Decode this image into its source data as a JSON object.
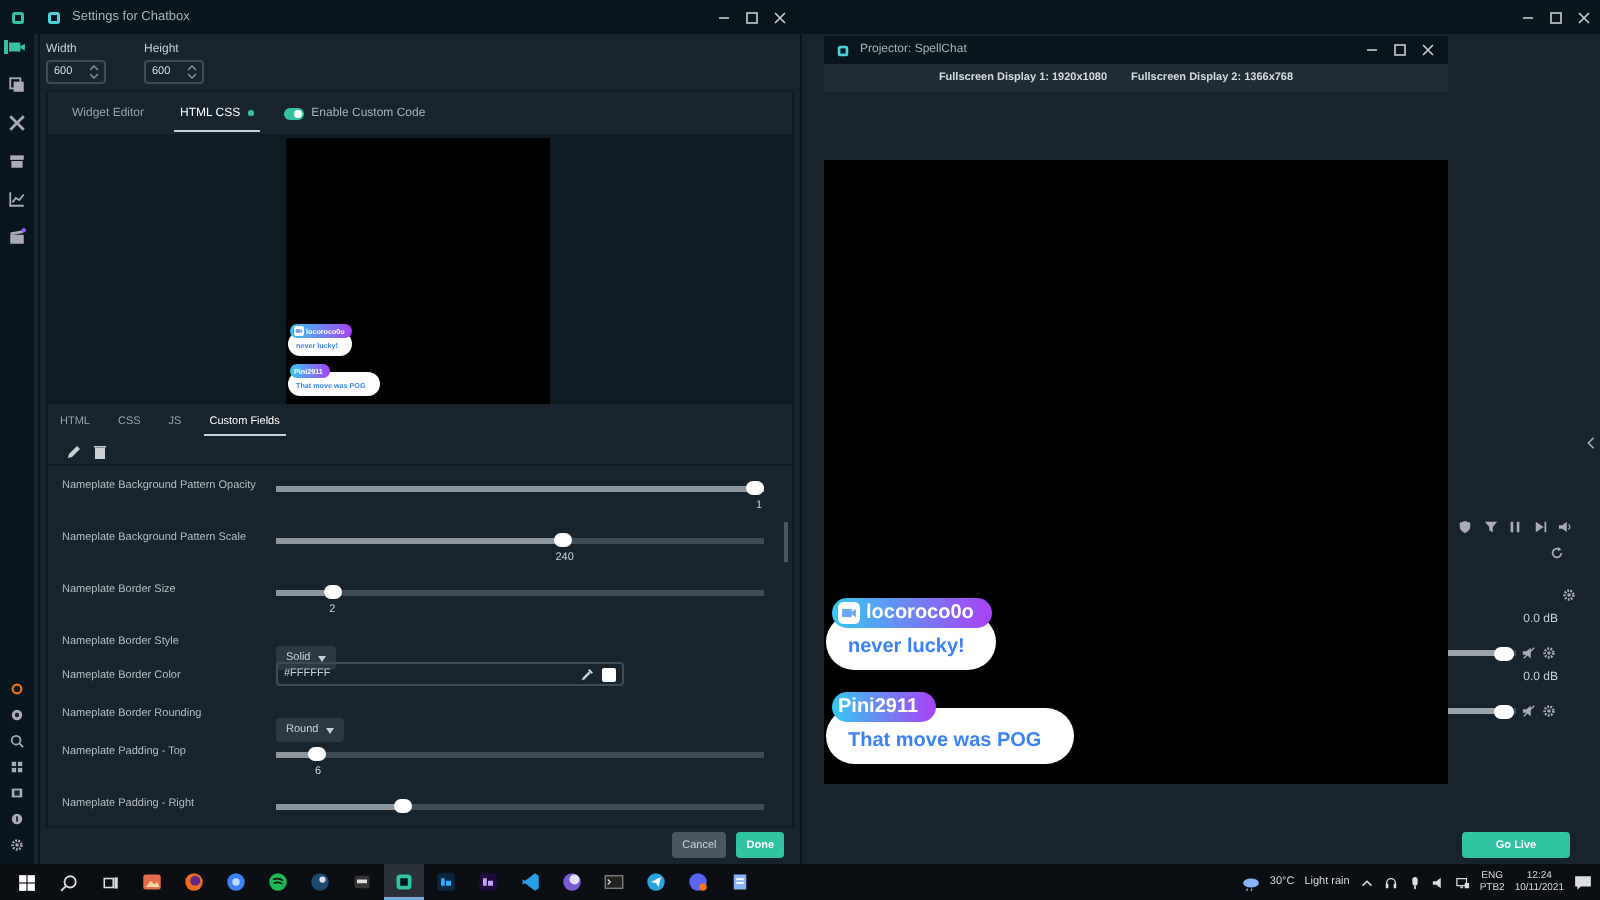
{
  "main_window": {
    "sidebar_top": [
      {
        "kind": "camera",
        "selected": true
      },
      {
        "kind": "layers",
        "selected": false
      },
      {
        "kind": "tools",
        "selected": false
      },
      {
        "kind": "store",
        "selected": false
      },
      {
        "kind": "chart",
        "selected": false
      },
      {
        "kind": "clapper",
        "selected": false
      }
    ],
    "sidebar_bottom": [
      {
        "kind": "ring"
      },
      {
        "kind": "circle"
      },
      {
        "kind": "search"
      },
      {
        "kind": "grid"
      },
      {
        "kind": "panel"
      },
      {
        "kind": "help"
      },
      {
        "kind": "gear"
      }
    ],
    "mixer": {
      "channels": [
        {
          "reading": "0.0 dB",
          "level": 0.94
        },
        {
          "reading": "0.0 dB",
          "level": 0.94
        }
      ]
    },
    "go_live": "Go Live"
  },
  "settings": {
    "title": "Settings for Chatbox",
    "width": {
      "label": "Width",
      "value": "600"
    },
    "height": {
      "label": "Height",
      "value": "600"
    },
    "tabs": [
      {
        "label": "Widget Editor",
        "selected": false,
        "modified": false
      },
      {
        "label": "HTML CSS",
        "selected": true,
        "modified": true
      }
    ],
    "custom_code": {
      "label": "Enable Custom Code",
      "on": true
    },
    "preview_messages": [
      {
        "name": "locoroco0o",
        "text": "never lucky!",
        "badge": true
      },
      {
        "name": "Pini2911",
        "text": "That move was POG",
        "badge": false
      }
    ],
    "code_tabs": [
      {
        "label": "HTML",
        "selected": false
      },
      {
        "label": "CSS",
        "selected": false
      },
      {
        "label": "JS",
        "selected": false
      },
      {
        "label": "Custom Fields",
        "selected": true
      }
    ],
    "fields": [
      {
        "kind": "slider",
        "label": "Nameplate Background Pattern Opacity",
        "level": 1,
        "reading": "1"
      },
      {
        "kind": "slider",
        "label": "Nameplate Background Pattern Scale",
        "level": 0.59,
        "reading": "240"
      },
      {
        "kind": "slider",
        "label": "Nameplate Border Size",
        "level": 0.1,
        "reading": "2"
      },
      {
        "kind": "select",
        "label": "Nameplate Border Style",
        "value": "Solid"
      },
      {
        "kind": "color",
        "label": "Nameplate Border Color",
        "value": "#FFFFFF"
      },
      {
        "kind": "select",
        "label": "Nameplate Border Rounding",
        "value": "Round"
      },
      {
        "kind": "slider",
        "label": "Nameplate Padding - Top",
        "level": 0.07,
        "reading": "6"
      },
      {
        "kind": "slider",
        "label": "Nameplate Padding - Right",
        "level": 0.25
      }
    ],
    "cancel": "Cancel",
    "done": "Done"
  },
  "projector": {
    "title": "Projector: SpellChat",
    "displays": [
      "Fullscreen Display 1: 1920x1080",
      "Fullscreen Display 2: 1366x768"
    ],
    "messages": [
      {
        "name": "locoroco0o",
        "text": "never lucky!",
        "badge": true
      },
      {
        "name": "Pini2911",
        "text": "That move was POG",
        "badge": false
      }
    ]
  },
  "taskbar": {
    "apps": [
      {
        "kind": "photos",
        "selected": false
      },
      {
        "kind": "fox",
        "selected": false
      },
      {
        "kind": "globe",
        "selected": false
      },
      {
        "kind": "music",
        "selected": false
      },
      {
        "kind": "steam",
        "selected": false
      },
      {
        "kind": "game",
        "selected": false
      },
      {
        "kind": "stream",
        "selected": true
      },
      {
        "kind": "ps",
        "selected": false
      },
      {
        "kind": "ae",
        "selected": false
      },
      {
        "kind": "code",
        "selected": false
      },
      {
        "kind": "moon",
        "selected": false
      },
      {
        "kind": "terminal",
        "selected": false
      },
      {
        "kind": "plane",
        "selected": false
      },
      {
        "kind": "chat",
        "selected": false
      },
      {
        "kind": "docs",
        "selected": false
      }
    ],
    "weather": {
      "temperature": "30°C",
      "condition": "Light rain"
    },
    "language": "ENG",
    "layout": "PTB2",
    "time": "12:24",
    "date": "10/11/2021"
  }
}
